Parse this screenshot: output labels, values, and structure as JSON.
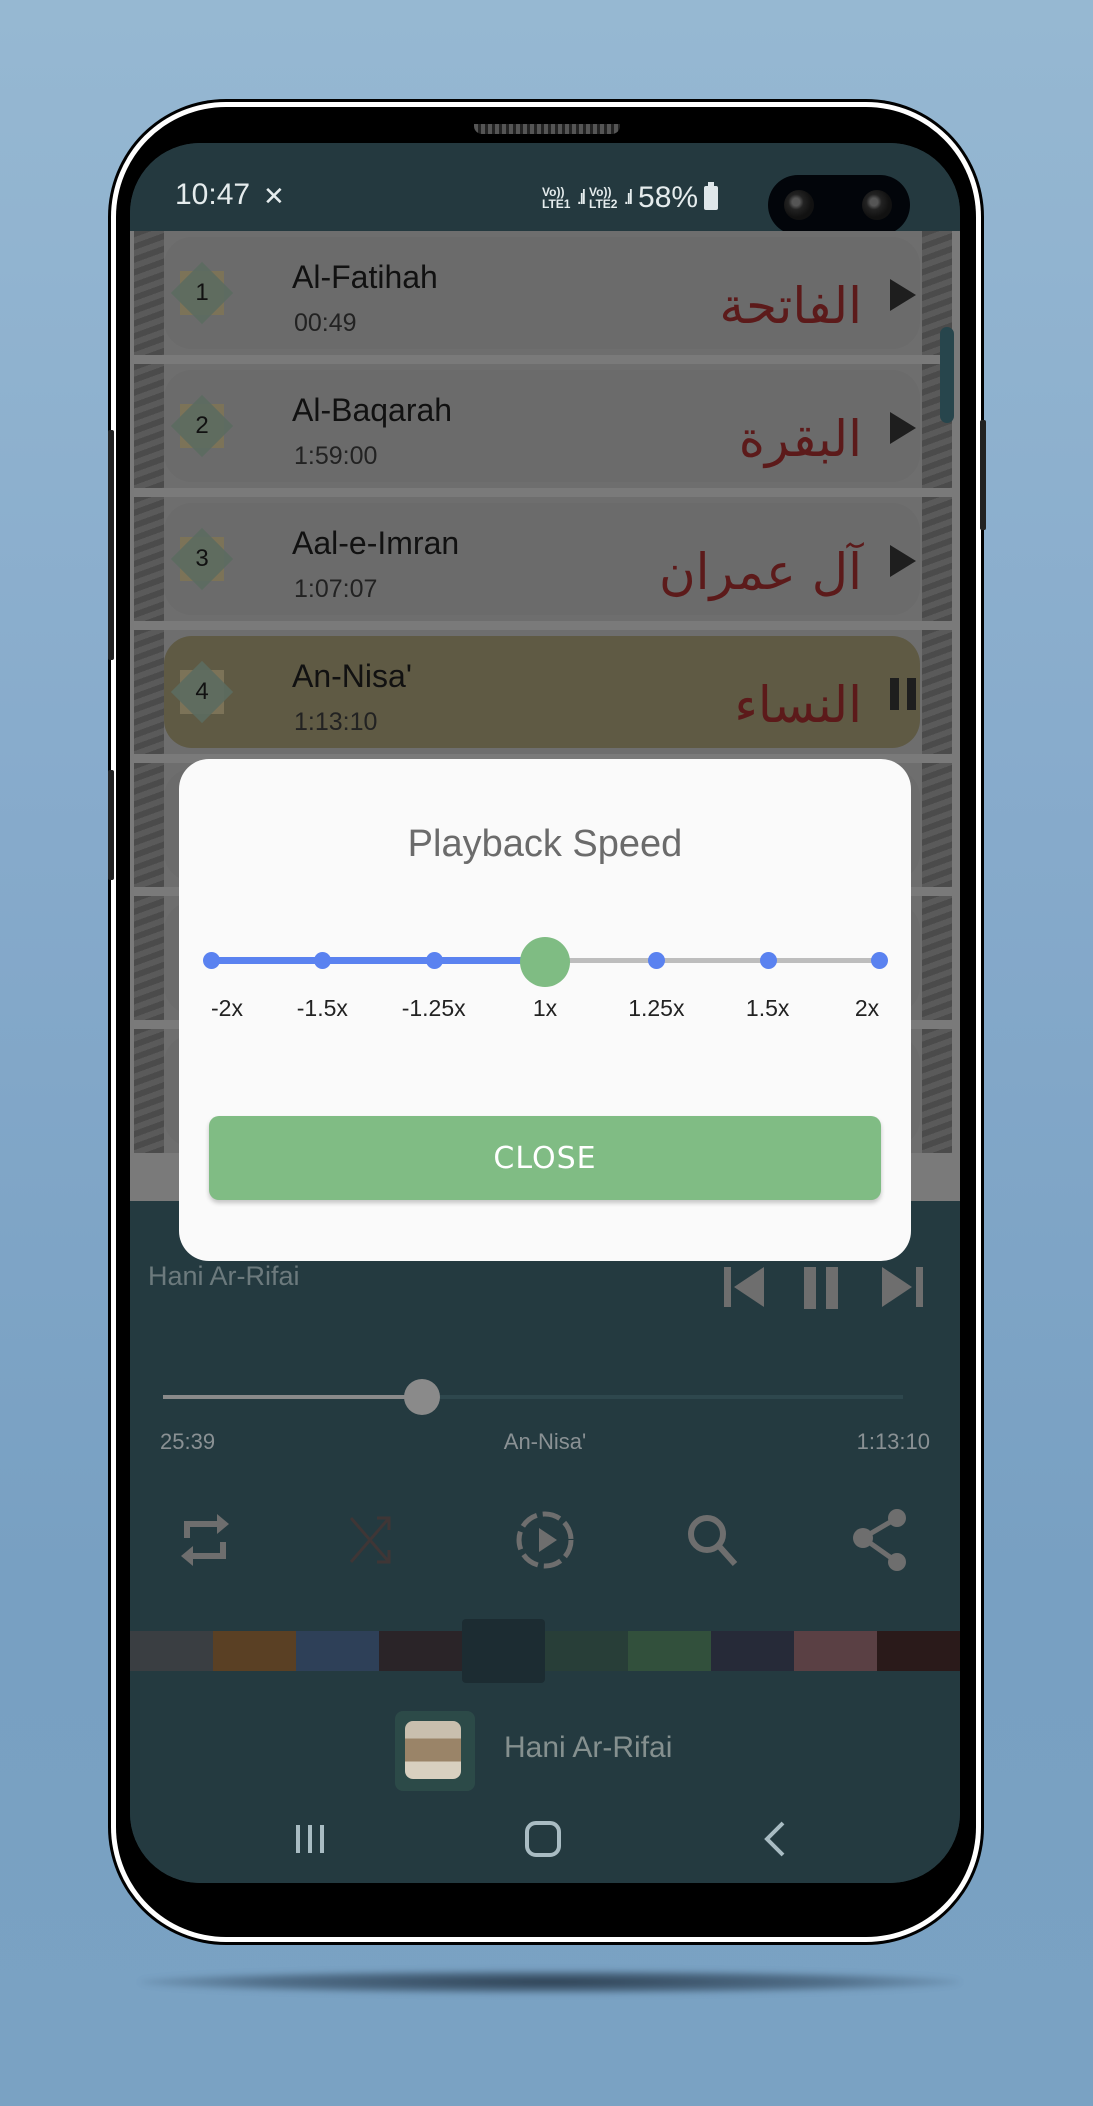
{
  "status_bar": {
    "time": "10:47",
    "app_icon": "quran-stand-icon",
    "sim1": {
      "volte": "Vo))",
      "label": "LTE1",
      "roaming": "R"
    },
    "sim2": {
      "volte": "Vo))",
      "label": "LTE2"
    },
    "battery": "58%"
  },
  "surah_list": [
    {
      "number": "1",
      "name": "Al-Fatihah",
      "duration": "00:49",
      "arabic": "الفاتحة",
      "state": "play"
    },
    {
      "number": "2",
      "name": "Al-Baqarah",
      "duration": "1:59:00",
      "arabic": "البقرة",
      "state": "play"
    },
    {
      "number": "3",
      "name": "Aal-e-Imran",
      "duration": "1:07:07",
      "arabic": "آل عمران",
      "state": "play"
    },
    {
      "number": "4",
      "name": "An-Nisa'",
      "duration": "1:13:10",
      "arabic": "النساء",
      "state": "pause"
    }
  ],
  "player": {
    "reciter_faded": "Hani Ar-Rifai",
    "current_time": "25:39",
    "track_title": "An-Nisa'",
    "total_time": "1:13:10",
    "progress_fraction": 0.35,
    "tools": [
      "repeat-icon",
      "shuffle-icon",
      "playback-speed-icon",
      "search-icon",
      "share-icon"
    ],
    "theme_colors": [
      "#3a3e42",
      "#5a4024",
      "#2e4058",
      "#2a2428",
      "#1c2c32",
      "#283e38",
      "#32503c",
      "#262a38",
      "#5a4044",
      "#2a1a1a"
    ],
    "selected_theme_index": 4,
    "reciter_name": "Hani Ar-Rifai"
  },
  "dialog": {
    "title": "Playback Speed",
    "speed_options": [
      "-2x",
      "-1.5x",
      "-1.25x",
      "1x",
      "1.25x",
      "1.5x",
      "2x"
    ],
    "selected_index": 3,
    "close_label": "CLOSE",
    "accent_color": "#5a82f0",
    "thumb_color": "#7fbc83"
  },
  "nav_bar": [
    "recent-apps-icon",
    "home-icon",
    "back-icon"
  ]
}
